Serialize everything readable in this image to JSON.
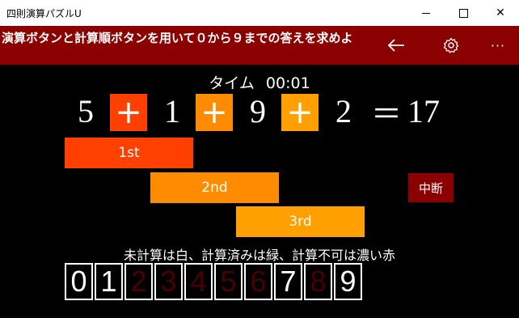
{
  "window": {
    "title": "四則演算パズルU",
    "minimize_icon": "minimize-icon",
    "maximize_icon": "maximize-icon",
    "close_icon": "close-icon",
    "close_glyph": "✕"
  },
  "appbar": {
    "instruction": "演算ボタンと計算順ボタンを用いて０から９までの答えを求めよ",
    "back_glyph": "←",
    "more_glyph": "···",
    "background": "#8b0000"
  },
  "timer": {
    "label": "タイム",
    "value": "00:01"
  },
  "equation": {
    "numbers": [
      "5",
      "1",
      "9",
      "2"
    ],
    "operators": [
      "+",
      "+",
      "+"
    ],
    "equals": "＝",
    "result": "17"
  },
  "order_buttons": {
    "first": "1st",
    "second": "2nd",
    "third": "3rd"
  },
  "abort_button": "中断",
  "legend": "未計算は白、計算済みは緑、計算不可は濃い赤",
  "answers": [
    {
      "digit": "0",
      "state": "white"
    },
    {
      "digit": "1",
      "state": "white"
    },
    {
      "digit": "2",
      "state": "dark"
    },
    {
      "digit": "3",
      "state": "dark"
    },
    {
      "digit": "4",
      "state": "dark"
    },
    {
      "digit": "5",
      "state": "dark"
    },
    {
      "digit": "6",
      "state": "dark"
    },
    {
      "digit": "7",
      "state": "white"
    },
    {
      "digit": "8",
      "state": "dark"
    },
    {
      "digit": "9",
      "state": "white"
    }
  ],
  "colors": {
    "first": "#ff4000",
    "second": "#ff8c00",
    "third": "#ffa000",
    "abort": "#8b0000",
    "not_computed": "#ffffff",
    "impossible": "#4a0000"
  }
}
